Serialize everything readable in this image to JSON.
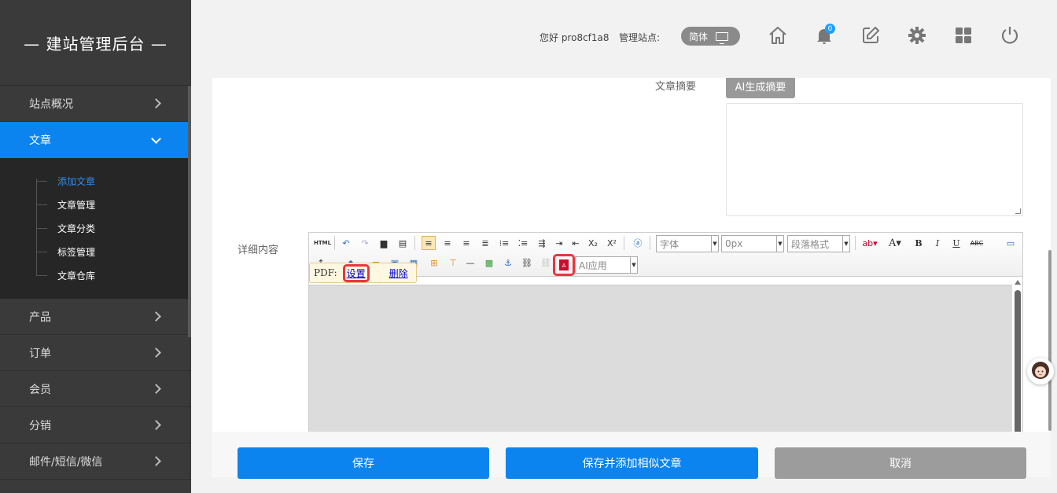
{
  "sidebar": {
    "brand": "— 建站管理后台 —",
    "items_top": [
      {
        "label": "站点概况"
      }
    ],
    "active": {
      "label": "文章"
    },
    "sub_items": [
      {
        "label": "添加文章"
      },
      {
        "label": "文章管理"
      },
      {
        "label": "文章分类"
      },
      {
        "label": "标签管理"
      },
      {
        "label": "文章仓库"
      }
    ],
    "items_bottom": [
      {
        "label": "产品"
      },
      {
        "label": "订单"
      },
      {
        "label": "会员"
      },
      {
        "label": "分销"
      },
      {
        "label": "邮件/短信/微信"
      }
    ]
  },
  "header": {
    "greeting": "您好 pro8cf1a8",
    "manage_site_label": "管理站点:",
    "lang_label": "简体",
    "notification_count": "0",
    "icons": [
      "home-icon",
      "bell-icon",
      "edit-icon",
      "gear-icon",
      "apps-grid-icon",
      "power-icon"
    ]
  },
  "form": {
    "summary_label": "文章摘要",
    "ai_summary_button": "AI生成摘要",
    "summary_value": "",
    "detail_label": "详细内容"
  },
  "editor": {
    "font_combo": "字体",
    "size_combo": "0px",
    "format_combo": "段落格式",
    "ai_combo": "AI应用",
    "pdf_popup": {
      "prefix": "PDF:",
      "settings": "设置",
      "delete": "删除"
    }
  },
  "footer": {
    "save": "保存",
    "save_add_similar": "保存并添加相似文章",
    "cancel": "取消"
  },
  "colors": {
    "accent": "#0b84f0",
    "sidebar": "#3a3a3a",
    "highlight": "#e8363f"
  }
}
